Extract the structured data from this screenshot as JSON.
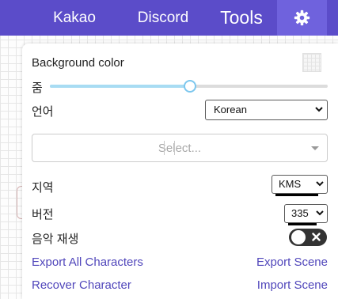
{
  "topbar": {
    "items": [
      "Kakao",
      "Discord",
      "Tools"
    ],
    "settings_icon": "gear-icon"
  },
  "settings": {
    "background_color_label": "Background color",
    "zoom_label": "줌",
    "zoom_value_fraction": 0.5,
    "language_label": "언어",
    "language_value": "Korean",
    "select_placeholder": "Select...",
    "region_label": "지역",
    "region_value": "KMS",
    "version_label": "버전",
    "version_value": "335",
    "music_label": "음악 재생",
    "music_enabled": false
  },
  "links": {
    "export_all": "Export All Characters",
    "export_scene": "Export Scene",
    "recover": "Recover Character",
    "import_scene": "Import Scene"
  },
  "colors": {
    "topbar": "#5b4cc9",
    "active_tab": "#6f62dd",
    "link": "#5046bb",
    "slider_fill": "#a8dcf3",
    "toggle_off": "#333333"
  }
}
